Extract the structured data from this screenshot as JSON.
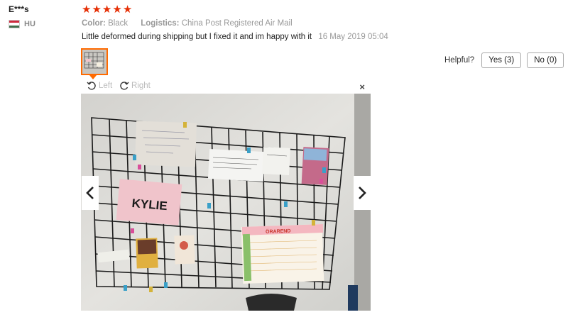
{
  "reviewer": {
    "name": "E***s",
    "country_code": "HU"
  },
  "rating": {
    "stars": 5
  },
  "attributes": [
    {
      "key": "Color:",
      "value": "Black"
    },
    {
      "key": "Logistics:",
      "value": "China Post Registered Air Mail"
    }
  ],
  "feedback": {
    "text": "Little deformed during shipping but I fixed it and im happy with it",
    "date": "16 May 2019 05:04"
  },
  "helpful": {
    "label": "Helpful?",
    "yes_label": "Yes (3)",
    "no_label": "No (0)"
  },
  "viewer": {
    "rotate_left_label": "Left",
    "rotate_right_label": "Right",
    "close_label": "×",
    "photo": {
      "kylie_card_text": "KYLIE",
      "calendar_header_text": "ÖRAREND"
    }
  },
  "colors": {
    "star": "#e62e04",
    "thumb_border": "#ff6a00",
    "wall": "#e2e1dd",
    "kylie_card": "#f0c4cb"
  },
  "icons": [
    "flag-hu-icon",
    "star-icon",
    "rotate-left-icon",
    "rotate-right-icon",
    "close-icon",
    "chevron-left-icon",
    "chevron-right-icon"
  ]
}
